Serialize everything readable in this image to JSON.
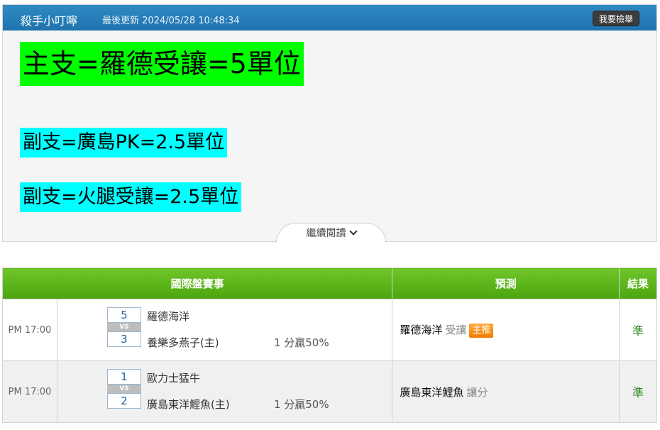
{
  "post": {
    "author": "殺手小叮嚀",
    "updated_label": "最後更新",
    "updated_time": "2024/05/28 10:48:34",
    "report_label": "我要檢舉",
    "headline_main": "主支=羅德受讓=5單位",
    "headline_sub1": "副支=廣島PK=2.5單位",
    "headline_sub2": "副支=火腿受讓=2.5單位",
    "read_more": "繼續閱讀",
    "colors": {
      "header": "#1f73ad",
      "highlight_main": "#00ff00",
      "highlight_sub": "#00ffff"
    }
  },
  "table": {
    "headers": {
      "event": "國際盤賽事",
      "prediction": "預測",
      "result": "結果"
    },
    "vs_label": "VS",
    "rows": [
      {
        "time": "PM 17:00",
        "score_a": "5",
        "score_b": "3",
        "team_a": "羅德海洋",
        "team_b": "養樂多燕子(主)",
        "odds": "1 分贏50%",
        "pick_team": "羅德海洋",
        "pick_type": "受讓",
        "badge": "主推",
        "result": "準"
      },
      {
        "time": "PM 17:00",
        "score_a": "1",
        "score_b": "2",
        "team_a": "歐力士猛牛",
        "team_b": "廣島東洋鯉魚(主)",
        "odds": "1 分贏50%",
        "pick_team": "廣島東洋鯉魚",
        "pick_type": "讓分",
        "result": "準"
      }
    ],
    "colors": {
      "header": "#4da50f",
      "result": "#2d8a1e",
      "badge": "#f07c00"
    }
  }
}
